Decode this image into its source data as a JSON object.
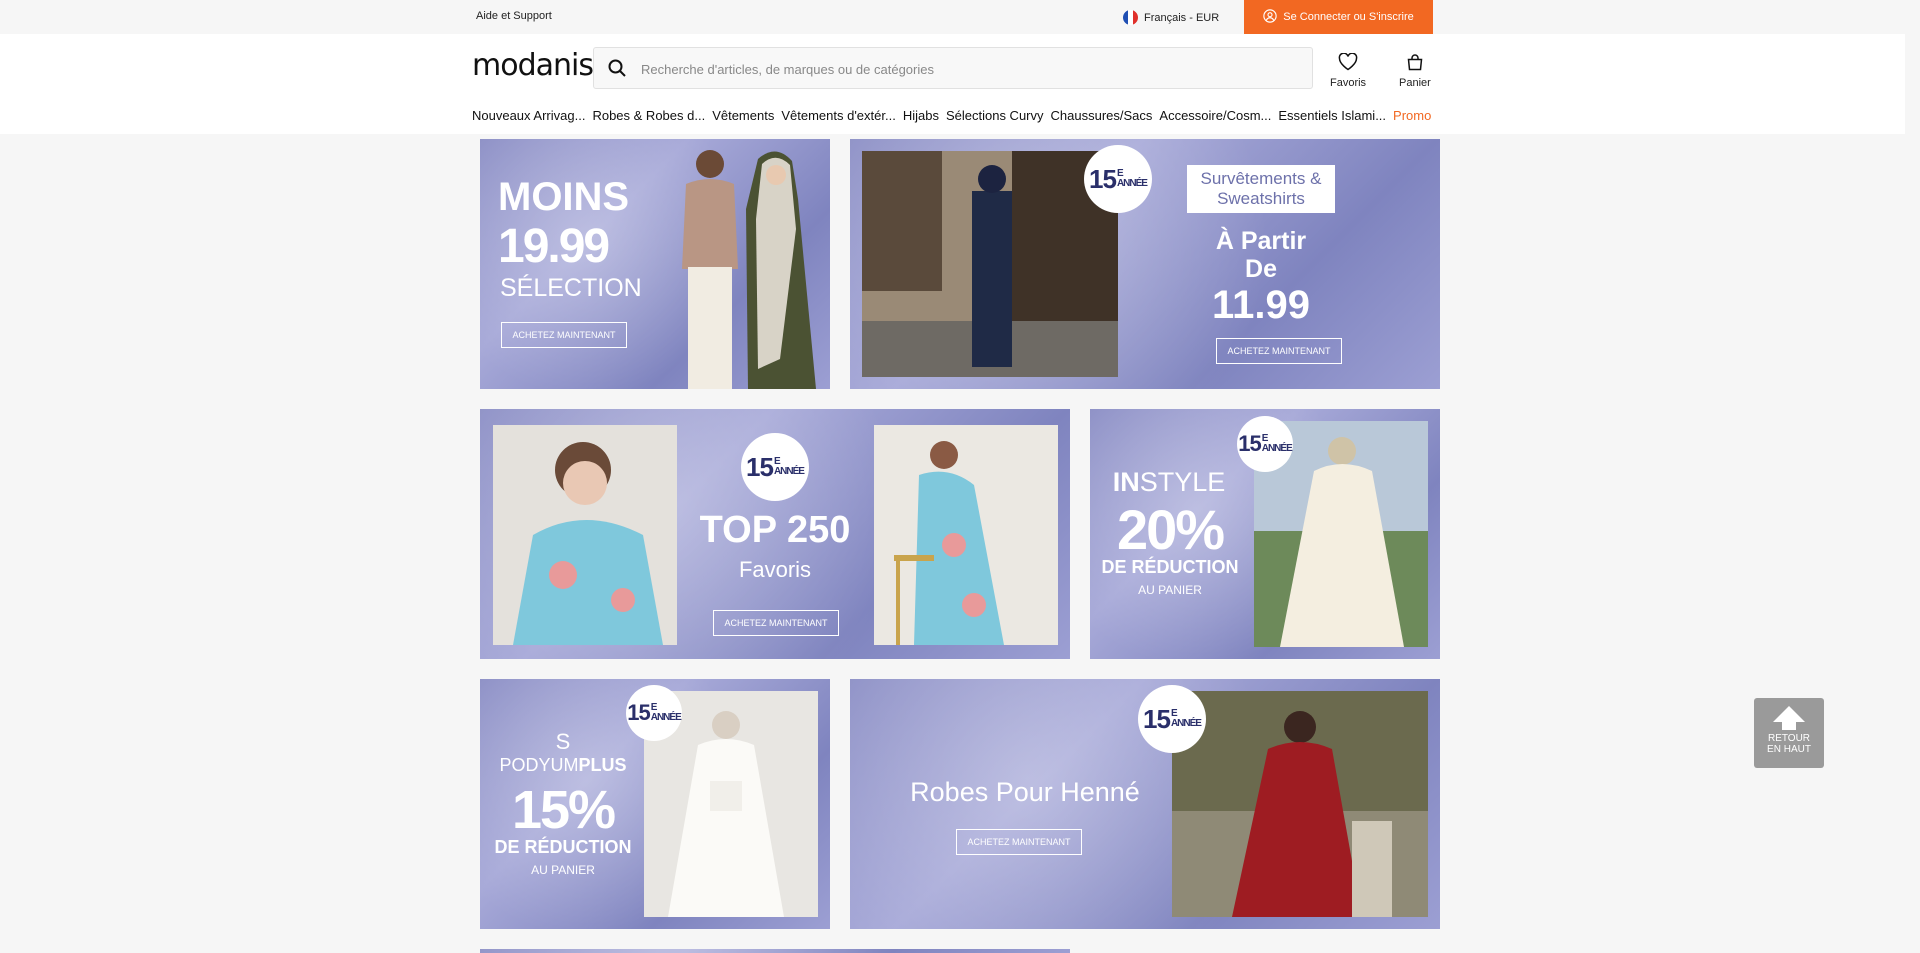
{
  "topbar": {
    "help": "Aide et Support",
    "language": "Français - EUR",
    "login": "Se Connecter ou S'inscrire"
  },
  "header": {
    "logo": "modanisa",
    "search_placeholder": "Recherche d'articles, de marques ou de catégories",
    "favorites": "Favoris",
    "cart": "Panier"
  },
  "nav": [
    "Nouveaux Arrivag...",
    "Robes & Robes d...",
    "Vêtements",
    "Vêtements d'extér...",
    "Hijabs",
    "Sélections Curvy",
    "Chaussures/Sacs",
    "Accessoire/Cosm...",
    "Essentiels Islami...",
    "Promo"
  ],
  "banners": {
    "b1": {
      "l1": "MOINS",
      "l2": "19.99",
      "l3": "SÉLECTION",
      "cta": "ACHETEZ MAINTENANT"
    },
    "b2": {
      "badge_num": "15",
      "badge_top": "E",
      "badge_bottom": "ANNÉE",
      "box1": "Survêtements &",
      "box2": "Sweatshirts",
      "l1": "À Partir",
      "l2": "De",
      "l3": "11.99",
      "cta": "ACHETEZ MAINTENANT"
    },
    "b3": {
      "badge_num": "15",
      "badge_top": "E",
      "badge_bottom": "ANNÉE",
      "l1": "TOP 250",
      "l2": "Favoris",
      "cta": "ACHETEZ MAINTENANT"
    },
    "b4": {
      "badge_num": "15",
      "badge_top": "E",
      "badge_bottom": "ANNÉE",
      "l1a": "IN",
      "l1b": "STYLE",
      "l2": "20%",
      "l3": "DE RÉDUCTION",
      "l4": "AU PANIER"
    },
    "b5": {
      "badge_num": "15",
      "badge_top": "E",
      "badge_bottom": "ANNÉE",
      "brand_mark": "S",
      "brand_a": "PODYUM",
      "brand_b": "PLUS",
      "l2": "15%",
      "l3": "DE RÉDUCTION",
      "l4": "AU PANIER"
    },
    "b6": {
      "badge_num": "15",
      "badge_top": "E",
      "badge_bottom": "ANNÉE",
      "l1": "Robes Pour Henné",
      "cta": "ACHETEZ MAINTENANT"
    }
  },
  "scroll_top": {
    "l1": "RETOUR",
    "l2": "EN HAUT"
  },
  "colors": {
    "accent": "#f26822",
    "banner": "#9598cc"
  }
}
